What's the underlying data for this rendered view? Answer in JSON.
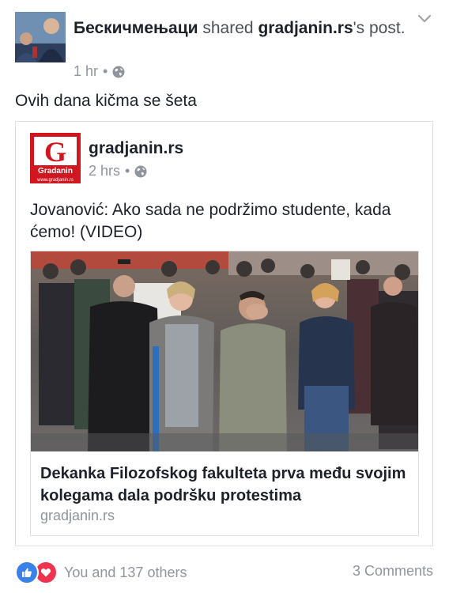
{
  "post": {
    "author": "Бескичмењаци",
    "action_text": "shared",
    "shared_from": "gradjanin.rs",
    "possessive_suffix": "'s",
    "object": "post.",
    "timestamp": "1 hr",
    "separator": "•",
    "privacy_icon": "globe-icon",
    "caption": "Ovih dana kičma se šeta"
  },
  "shared_post": {
    "page_name": "gradjanin.rs",
    "timestamp": "2 hrs",
    "separator": "•",
    "privacy_icon": "globe-icon",
    "text": "Jovanović: Ako sada ne podržimo studente, kada ćemo! (VIDEO)",
    "logo": {
      "letter": "G",
      "brand": "Gradanin",
      "url": "www.gradjanin.rs",
      "color": "#d0161e"
    },
    "link": {
      "title": "Dekanka Filozofskog fakulteta prva među svojim kolegama dala podršku protestima",
      "domain": "gradjanin.rs"
    }
  },
  "footer": {
    "reaction_icons": [
      "like-icon",
      "love-icon"
    ],
    "reactions_text": "You and 137 others",
    "comments": "3 Comments"
  },
  "colors": {
    "like": "#3b82e8",
    "love": "#f0334f",
    "meta": "#90949c",
    "border": "#dddfe2"
  }
}
